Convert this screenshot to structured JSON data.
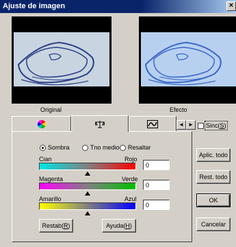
{
  "window": {
    "title": "Ajuste de imagen",
    "close_label": "×"
  },
  "previews": {
    "original_label": "Original",
    "effect_label": "Efecto"
  },
  "tabs": [
    {
      "icon": "color-wheel-icon",
      "active": false
    },
    {
      "icon": "balance-scale-icon",
      "active": true
    },
    {
      "icon": "curve-icon",
      "active": false
    }
  ],
  "tab_scroll": {
    "left": "◄",
    "right": "►"
  },
  "tone_range": {
    "options": [
      "Sombra",
      "Tno medio",
      "Resaltar"
    ],
    "selected": "Sombra"
  },
  "sliders": [
    {
      "left_label": "Cian",
      "right_label": "Rojo",
      "value": "0",
      "from": "#00e5e5",
      "to": "#ff0000"
    },
    {
      "left_label": "Magenta",
      "right_label": "Verde",
      "value": "0",
      "from": "#ff00ff",
      "to": "#00c000"
    },
    {
      "left_label": "Amarillo",
      "right_label": "Azul",
      "value": "0",
      "from": "#ffff00",
      "to": "#0000ff"
    }
  ],
  "panel_buttons": {
    "reset_text": "Restab(",
    "reset_key": "R",
    "help_text": "Ayuda(",
    "help_key": "H",
    "close_paren": ")"
  },
  "sync": {
    "text": "Sinc(",
    "key": "S",
    "close_paren": ")",
    "checked": false
  },
  "side_buttons": {
    "apply_all": "Aplic. todo",
    "reset_all": "Rest. todo",
    "ok": "OK",
    "cancel": "Cancelar"
  },
  "colors": {
    "titlebar": "#0a246a",
    "face": "#d4d0c8"
  }
}
